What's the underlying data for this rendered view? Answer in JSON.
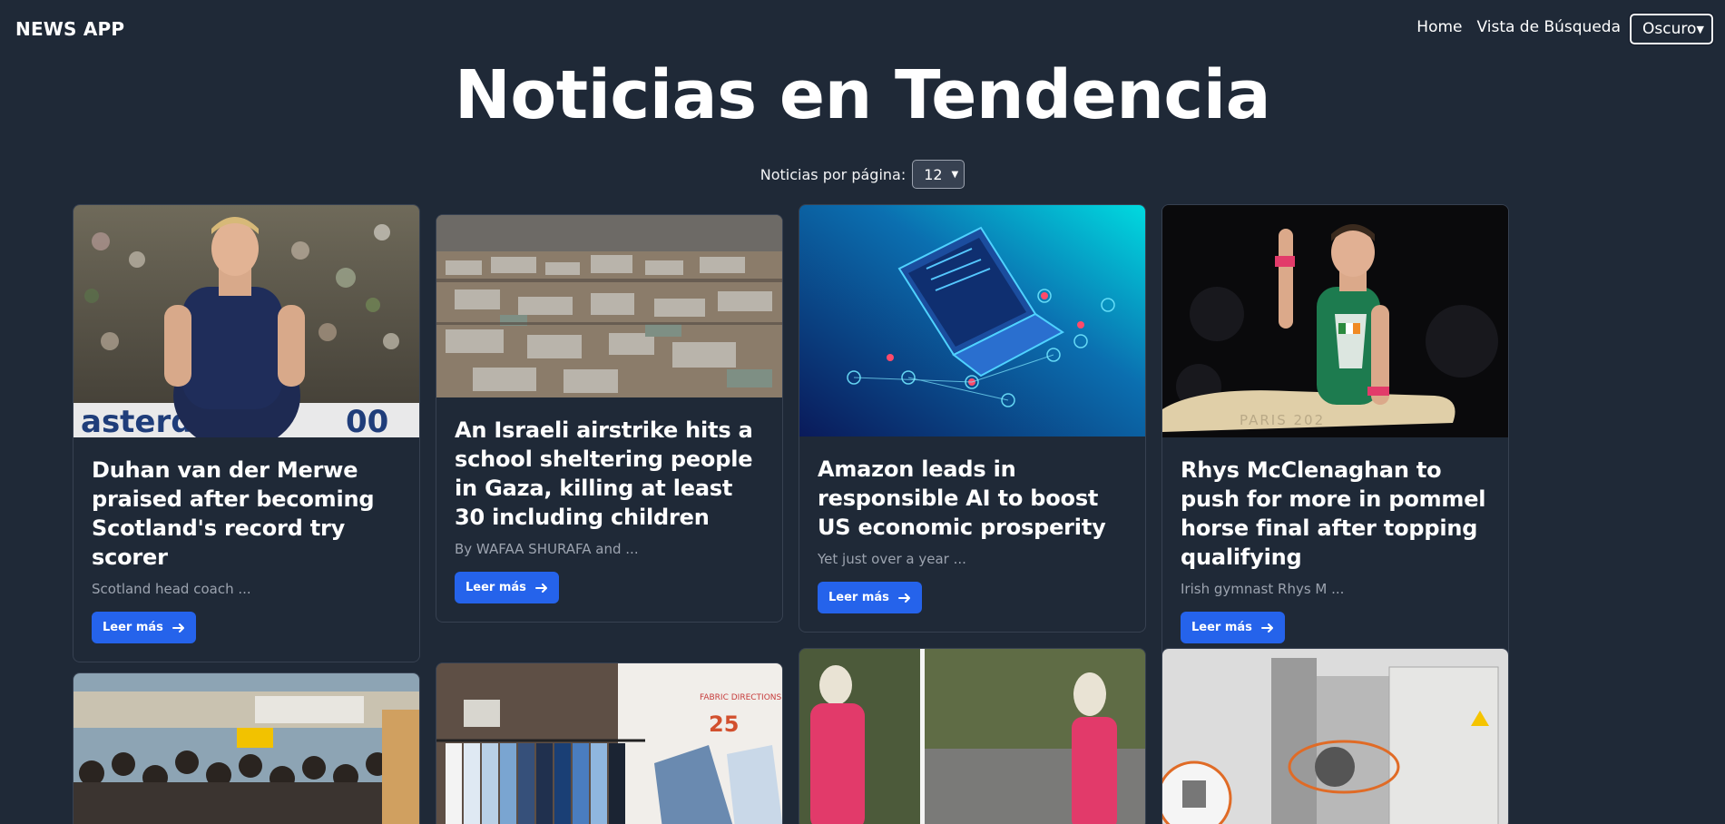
{
  "app": {
    "brand": "NEWS APP"
  },
  "nav": {
    "links": [
      {
        "label": "Home"
      },
      {
        "label": "Vista de Búsqueda"
      }
    ],
    "theme_select": {
      "value": "Oscuro"
    }
  },
  "page": {
    "title": "Noticias en Tendencia",
    "per_page_label": "Noticias por página:",
    "per_page_value": "12"
  },
  "articles": [
    {
      "title": "Duhan van der Merwe praised after becoming Scotland's record try scorer",
      "excerpt": "Scotland head coach ...",
      "button": "Leer más",
      "image": "rugby-player-photo"
    },
    {
      "title": "An Israeli airstrike hits a school sheltering people in Gaza, killing at least 30 including children",
      "excerpt": "By WAFAA SHURAFA and ...",
      "button": "Leer más",
      "image": "gaza-camp-aerial-photo"
    },
    {
      "title": "Amazon leads in responsible AI to boost US economic prosperity",
      "excerpt": "Yet just over a year ...",
      "button": "Leer más",
      "image": "laptop-network-illustration"
    },
    {
      "title": "Rhys McClenaghan to push for more in pommel horse final after topping qualifying",
      "excerpt": "Irish gymnast Rhys M ...",
      "button": "Leer más",
      "image": "gymnast-photo"
    },
    {
      "image": "crowd-photo"
    },
    {
      "image": "clothing-display-photo"
    },
    {
      "image": "cctv-woman-photo"
    },
    {
      "image": "industrial-machine-photo"
    }
  ]
}
